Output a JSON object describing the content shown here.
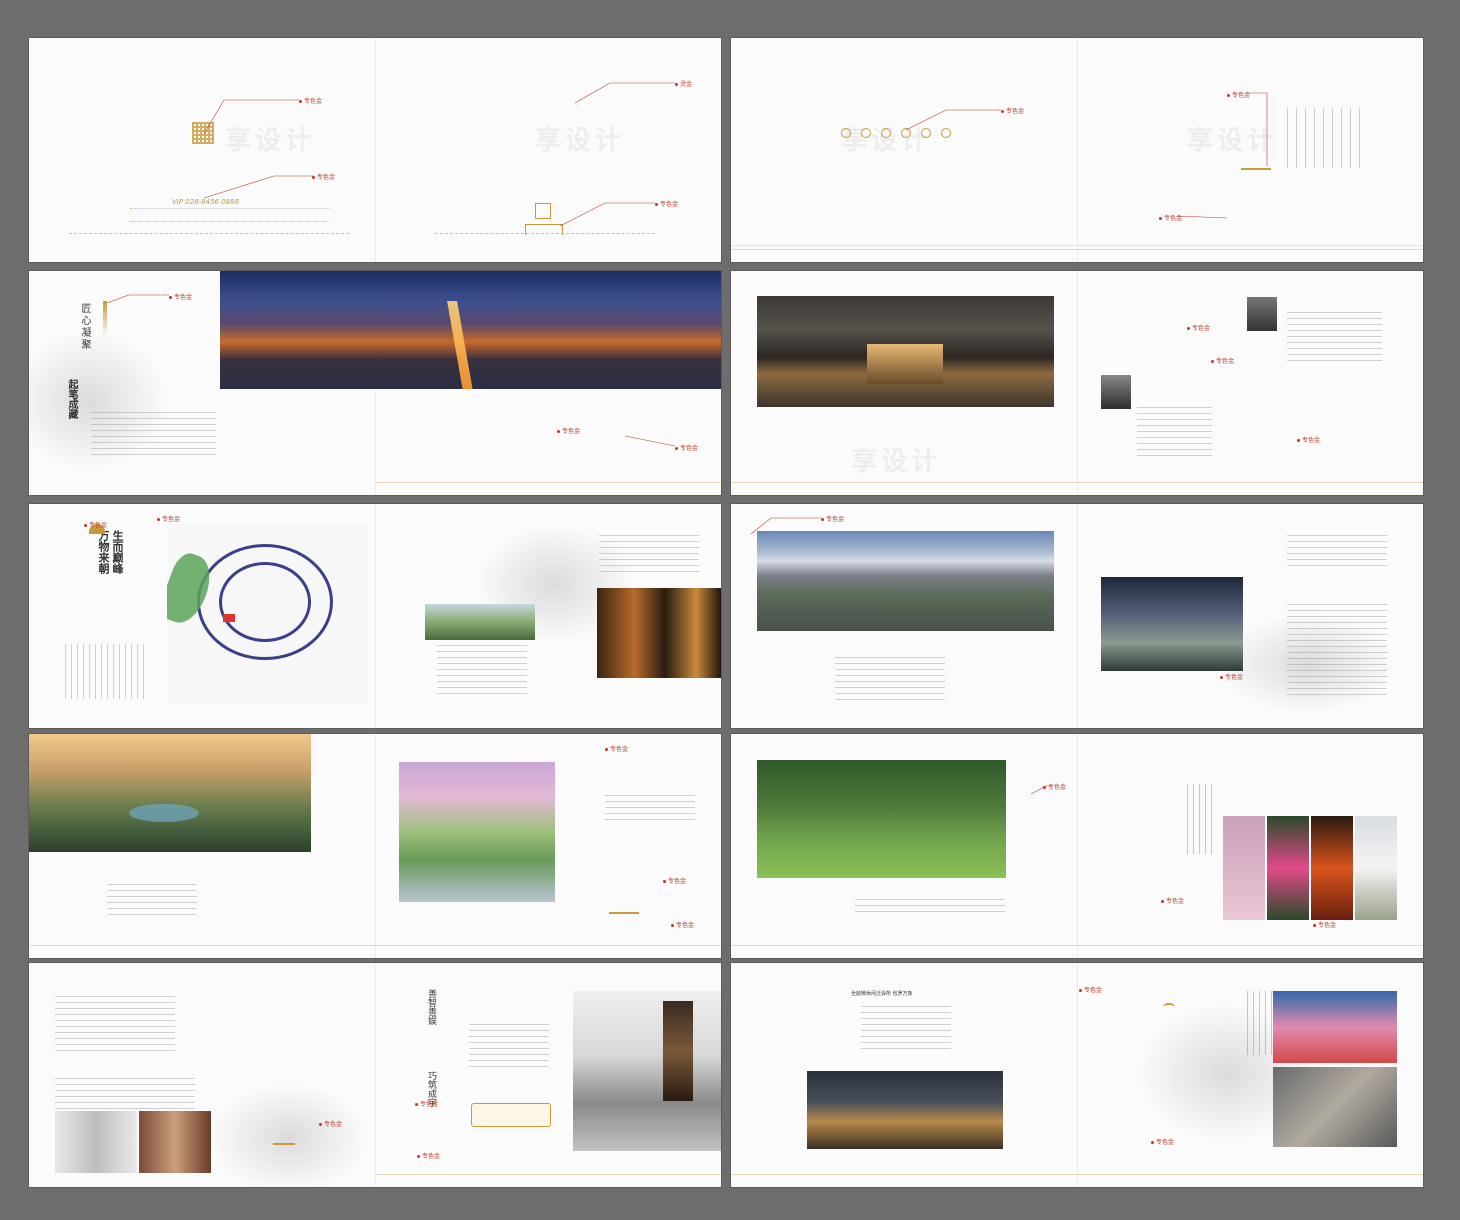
{
  "labels": {
    "special_gold": "专色金",
    "hot_stamp": "烫金"
  },
  "cover": {
    "vip": "VIP 028-8456 0888"
  },
  "spread3": {
    "title_vertical": "匠心凝聚",
    "subtitle_vertical": "起笔成藏"
  },
  "spread5": {
    "title_a": "生而巅峰",
    "title_b": "万物来朝"
  },
  "spread9": {
    "title_a": "善智善娱",
    "title_b": "巧筑成宇"
  },
  "spread10": {
    "heading": "全龄微休闲泛会所 包罗万象"
  },
  "colors": {
    "accent_red": "#c0392b",
    "gold": "#c99a3c",
    "page": "#fbfbfb",
    "background": "#6d6d6d"
  }
}
